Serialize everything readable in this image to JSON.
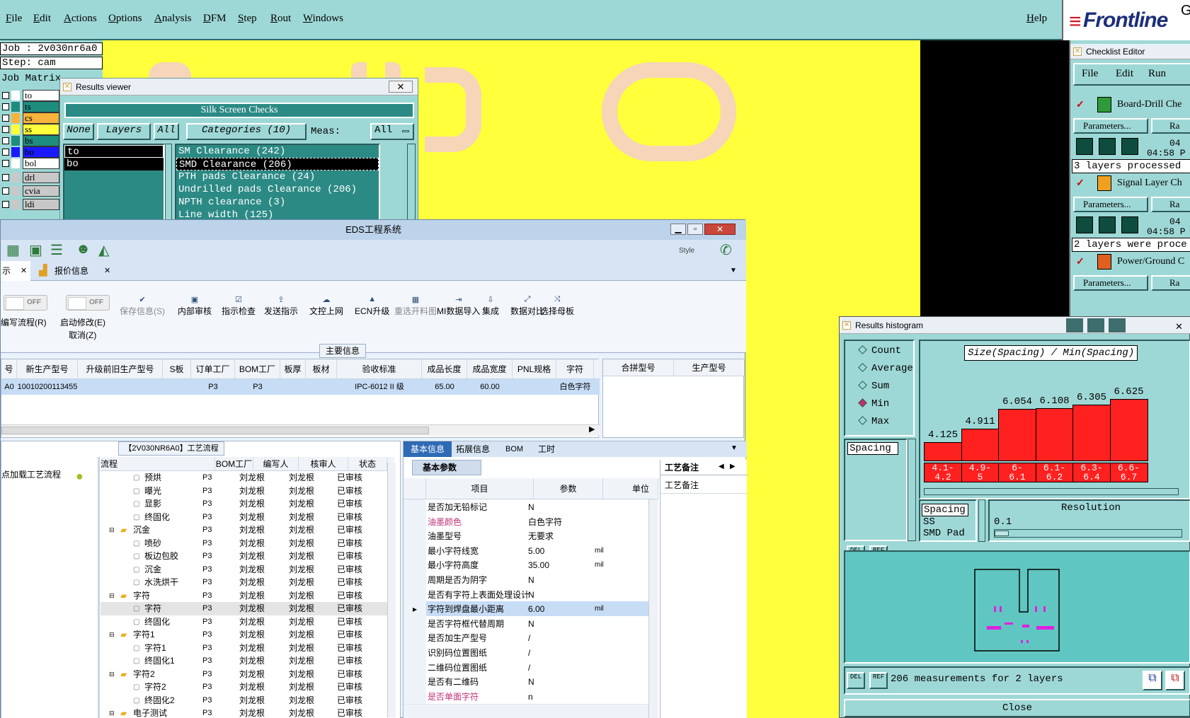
{
  "menubar": {
    "items": [
      "File",
      "Edit",
      "Actions",
      "Options",
      "Analysis",
      "DFM",
      "Step",
      "Rout",
      "Windows"
    ],
    "help": "Help",
    "brand": "Frontline",
    "brand_suffix": "G"
  },
  "left_panel": {
    "job_label": "Job : 2v030nr6a0",
    "step_label": "Step: cam",
    "matrix_label": "Job Matrix",
    "layers": [
      {
        "name": "to",
        "color": "#ffffff"
      },
      {
        "name": "ts",
        "color": "#1e8c7e"
      },
      {
        "name": "cs",
        "color": "#f6b43c"
      },
      {
        "name": "ss",
        "color": "#ffff3c"
      },
      {
        "name": "bs",
        "color": "#1e8c7e"
      },
      {
        "name": "bo",
        "color": "#1a1aff"
      },
      {
        "name": "bol",
        "color": "#ffffff"
      },
      {
        "name": "drl",
        "color": "#c8c8c8"
      },
      {
        "name": "cvia",
        "color": "#c8c8c8"
      },
      {
        "name": "ldi",
        "color": "#c8c8c8"
      }
    ]
  },
  "results_viewer": {
    "title": "Results viewer",
    "header": "Silk Screen Checks",
    "btn_none": "None",
    "btn_layers": "Layers",
    "btn_all": "All",
    "btn_categories": "Categories (10)",
    "meas_label": "Meas:",
    "meas_value": "All",
    "layers": [
      "to",
      "bo"
    ],
    "categories": [
      "SM Clearance (242)",
      "SMD Clearance (206)",
      "PTH pads Clearance (24)",
      "Undrilled pads Clearance (206)",
      "NPTH clearance (3)",
      "Line width (125)"
    ]
  },
  "eds": {
    "title": "EDS工程系统",
    "style_label": "Style",
    "tabs": [
      "示",
      "报价信息"
    ],
    "toggle_off": "OFF",
    "ribbon": [
      {
        "label": "编写流程(R)",
        "icon": ""
      },
      {
        "label": "启动修改(E)",
        "icon": ""
      },
      {
        "label": "取消(Z)",
        "icon": ""
      },
      {
        "label": "保存信息(S)",
        "icon": "✔"
      },
      {
        "label": "内部审核",
        "icon": "▣"
      },
      {
        "label": "指示检查",
        "icon": "☑"
      },
      {
        "label": "发送指示",
        "icon": "⇪"
      },
      {
        "label": "文控上网",
        "icon": "☁"
      },
      {
        "label": "ECN升级",
        "icon": "▲"
      },
      {
        "label": "重选开料图",
        "icon": "▦"
      },
      {
        "label": "MI数据导入",
        "icon": "⇥"
      },
      {
        "label": "集成",
        "icon": "⇩"
      },
      {
        "label": "数据对比",
        "icon": "⤢"
      },
      {
        "label": "选择母板",
        "icon": "⤨"
      }
    ],
    "main_info_label": "主要信息",
    "grid_headers": [
      "号",
      "新生产型号",
      "升级前旧生产型号",
      "S板",
      "订单工厂",
      "BOM工厂",
      "板厚",
      "板材",
      "验收标准",
      "成品长度",
      "成品宽度",
      "PNL规格",
      "字符"
    ],
    "grid_row": [
      "A0",
      "10010200113455",
      "",
      "",
      "P3",
      "P3",
      "",
      "",
      "IPC-6012 II 级",
      "65.00",
      "60.00",
      "",
      "白色字符"
    ],
    "right_grid_headers": [
      "合拼型号",
      "生产型号"
    ],
    "process_title": "【2V030NR6A0】工艺流程",
    "load_process": "点加载工艺流程",
    "tree_headers": [
      "流程",
      "BOM工厂",
      "编写人",
      "核审人",
      "状态"
    ],
    "tree_rows": [
      {
        "name": "预烘",
        "level": 2,
        "factory": "P3",
        "writer": "刘龙根",
        "reviewer": "刘龙根",
        "status": "已审核"
      },
      {
        "name": "曝光",
        "level": 2,
        "factory": "P3",
        "writer": "刘龙根",
        "reviewer": "刘龙根",
        "status": "已审核"
      },
      {
        "name": "显影",
        "level": 2,
        "factory": "P3",
        "writer": "刘龙根",
        "reviewer": "刘龙根",
        "status": "已审核"
      },
      {
        "name": "终固化",
        "level": 2,
        "factory": "P3",
        "writer": "刘龙根",
        "reviewer": "刘龙根",
        "status": "已审核"
      },
      {
        "name": "沉金",
        "level": 1,
        "factory": "P3",
        "writer": "刘龙根",
        "reviewer": "刘龙根",
        "status": "已审核"
      },
      {
        "name": "喷砂",
        "level": 2,
        "factory": "P3",
        "writer": "刘龙根",
        "reviewer": "刘龙根",
        "status": "已审核"
      },
      {
        "name": "板边包胶",
        "level": 2,
        "factory": "P3",
        "writer": "刘龙根",
        "reviewer": "刘龙根",
        "status": "已审核"
      },
      {
        "name": "沉金",
        "level": 2,
        "factory": "P3",
        "writer": "刘龙根",
        "reviewer": "刘龙根",
        "status": "已审核"
      },
      {
        "name": "水洗烘干",
        "level": 2,
        "factory": "P3",
        "writer": "刘龙根",
        "reviewer": "刘龙根",
        "status": "已审核"
      },
      {
        "name": "字符",
        "level": 1,
        "factory": "P3",
        "writer": "刘龙根",
        "reviewer": "刘龙根",
        "status": "已审核"
      },
      {
        "name": "字符",
        "level": 2,
        "factory": "P3",
        "writer": "刘龙根",
        "reviewer": "刘龙根",
        "status": "已审核"
      },
      {
        "name": "终固化",
        "level": 2,
        "factory": "P3",
        "writer": "刘龙根",
        "reviewer": "刘龙根",
        "status": "已审核"
      },
      {
        "name": "字符1",
        "level": 1,
        "factory": "P3",
        "writer": "刘龙根",
        "reviewer": "刘龙根",
        "status": "已审核"
      },
      {
        "name": "字符1",
        "level": 2,
        "factory": "P3",
        "writer": "刘龙根",
        "reviewer": "刘龙根",
        "status": "已审核"
      },
      {
        "name": "终固化1",
        "level": 2,
        "factory": "P3",
        "writer": "刘龙根",
        "reviewer": "刘龙根",
        "status": "已审核"
      },
      {
        "name": "字符2",
        "level": 1,
        "factory": "P3",
        "writer": "刘龙根",
        "reviewer": "刘龙根",
        "status": "已审核"
      },
      {
        "name": "字符2",
        "level": 2,
        "factory": "P3",
        "writer": "刘龙根",
        "reviewer": "刘龙根",
        "status": "已审核"
      },
      {
        "name": "终固化2",
        "level": 2,
        "factory": "P3",
        "writer": "刘龙根",
        "reviewer": "刘龙根",
        "status": "已审核"
      },
      {
        "name": "电子测试",
        "level": 1,
        "factory": "P3",
        "writer": "刘龙根",
        "reviewer": "刘龙根",
        "status": "已审核"
      }
    ],
    "detail_tabs": [
      "基本信息",
      "拓展信息",
      "BOM",
      "工时"
    ],
    "basic_params": "基本参数",
    "param_headers": [
      "项目",
      "参数",
      "单位"
    ],
    "params": [
      {
        "item": "是否加无铅标记",
        "value": "N",
        "unit": "",
        "pink": false
      },
      {
        "item": "油墨颜色",
        "value": "白色字符",
        "unit": "",
        "pink": true
      },
      {
        "item": "油墨型号",
        "value": "无要求",
        "unit": "",
        "pink": false
      },
      {
        "item": "最小字符线宽",
        "value": "5.00",
        "unit": "mil",
        "pink": false
      },
      {
        "item": "最小字符高度",
        "value": "35.00",
        "unit": "mil",
        "pink": false
      },
      {
        "item": "周期是否为阴字",
        "value": "N",
        "unit": "",
        "pink": false
      },
      {
        "item": "是否有字符上表面处理设计",
        "value": "N",
        "unit": "",
        "pink": false
      },
      {
        "item": "字符到焊盘最小距离",
        "value": "6.00",
        "unit": "mil",
        "pink": false
      },
      {
        "item": "是否字符框代替周期",
        "value": "N",
        "unit": "",
        "pink": false
      },
      {
        "item": "是否加生产型号",
        "value": "/",
        "unit": "",
        "pink": false
      },
      {
        "item": "识别码位置图纸",
        "value": "/",
        "unit": "",
        "pink": false
      },
      {
        "item": "二维码位置图纸",
        "value": "/",
        "unit": "",
        "pink": false
      },
      {
        "item": "是否有二维码",
        "value": "N",
        "unit": "",
        "pink": false
      },
      {
        "item": "是否单面字符",
        "value": "n",
        "unit": "",
        "pink": true
      }
    ],
    "remark_tab": "工艺备注",
    "remark_label": "工艺备注"
  },
  "checklist": {
    "title": "Checklist Editor",
    "menu": [
      "File",
      "Edit",
      "Run"
    ],
    "entries": [
      {
        "name": "Board-Drill Che",
        "params": "Parameters...",
        "run": "Ra",
        "date": "04",
        "time": "04:58 P",
        "status": "3 layers processed"
      },
      {
        "name": "Signal Layer Ch",
        "params": "Parameters...",
        "run": "Ra",
        "date": "04",
        "time": "04:58 P",
        "status": "2 layers were proce"
      },
      {
        "name": "Power/Ground C",
        "params": "Parameters...",
        "run": "Ra",
        "date": "",
        "time": "",
        "status": ""
      }
    ]
  },
  "histogram": {
    "title": "Results histogram",
    "modes": [
      "Count",
      "Average",
      "Sum",
      "Min",
      "Max"
    ],
    "selected_mode": "Min",
    "spacing_item": "Spacing",
    "chart_title": "Size(Spacing) / Min(Spacing)",
    "bars": [
      {
        "value": 4.125,
        "bin": "4.1-\n4.2"
      },
      {
        "value": 4.911,
        "bin": "4.9-\n5"
      },
      {
        "value": 6.054,
        "bin": "6-\n6.1"
      },
      {
        "value": 6.108,
        "bin": "6.1-\n6.2"
      },
      {
        "value": 6.305,
        "bin": "6.3-\n6.4"
      },
      {
        "value": 6.625,
        "bin": "6.6-\n6.7"
      }
    ],
    "value_labels": [
      "4.125",
      "4.911",
      "6.054",
      "6.108",
      "6.305",
      "6.625"
    ],
    "filter_items": [
      "Spacing",
      "SS",
      "SMD Pad"
    ],
    "resolution_label": "Resolution",
    "resolution_value": "0.1",
    "del_label": "DEL",
    "ref_label": "REF",
    "summary": "206 measurements for 2 layers",
    "close": "Close"
  }
}
